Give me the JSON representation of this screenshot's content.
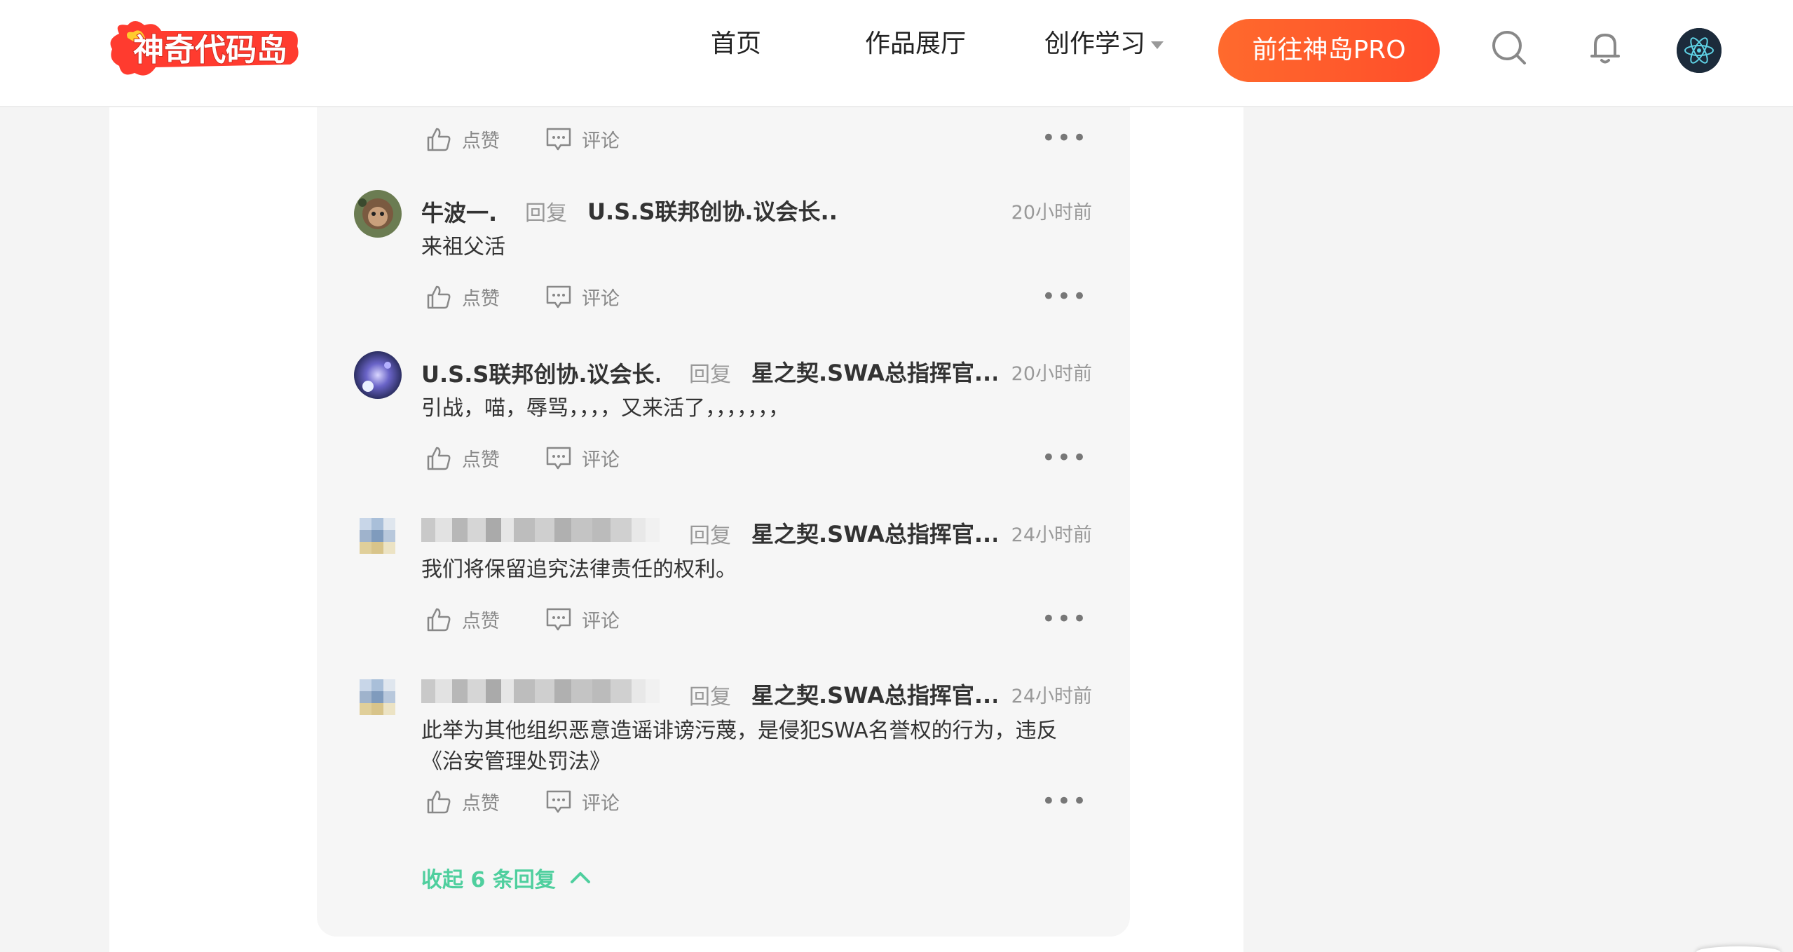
{
  "header": {
    "logo_text": "神奇代码岛",
    "nav": [
      {
        "label": "首页"
      },
      {
        "label": "作品展厅"
      },
      {
        "label": "创作学习"
      }
    ],
    "pro_button": "前往神岛PRO"
  },
  "actions": {
    "like": "点赞",
    "comment": "评论",
    "more": "•••"
  },
  "comments": [
    {
      "author": "牛波一.",
      "reply_word": "回复",
      "reply_to": "U.S.S联邦创协.议会长...",
      "time": "20小时前",
      "content": "来祖父活"
    },
    {
      "author": "U.S.S联邦创协.议会长...",
      "reply_word": "回复",
      "reply_to": "星之契.SWA总指挥官...",
      "time": "20小时前",
      "content": "引战，喵，辱骂，，，，又来活了，，，，，，，"
    },
    {
      "author": "",
      "reply_word": "回复",
      "reply_to": "星之契.SWA总指挥官...",
      "time": "24小时前",
      "content": "我们将保留追究法律责任的权利。"
    },
    {
      "author": "",
      "reply_word": "回复",
      "reply_to": "星之契.SWA总指挥官...",
      "time": "24小时前",
      "content": "此举为其他组织恶意造谣诽谤污蔑，是侵犯SWA名誉权的行为，违反《治安管理处罚法》"
    }
  ],
  "collapse_label": "收起 6 条回复",
  "colors": {
    "accent_green": "#4fcf9e",
    "pro_orange": "#ff5a2b",
    "logo_red": "#ff3b2f"
  }
}
